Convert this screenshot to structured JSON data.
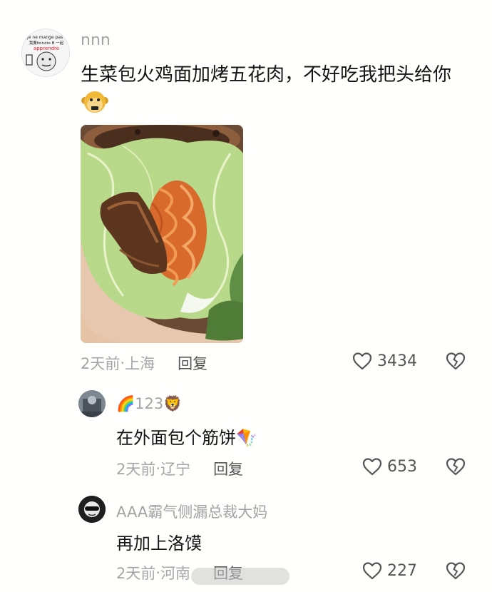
{
  "comments": [
    {
      "username": "nnn",
      "text": "生菜包火鸡面加烤五花肉，不好吃我把头给你",
      "emoji": "monkey-emoji",
      "avatar_text": {
        "line1": "Je ne mange pas ,",
        "line2": "我要feindre B 一起",
        "line3": "apprendre"
      },
      "time": "2天前",
      "location": "上海",
      "reply_label": "回复",
      "likes": "3434"
    },
    {
      "username": "🌈123🦁",
      "text": "在外面包个筋饼🪁",
      "time": "2天前",
      "location": "辽宁",
      "reply_label": "回复",
      "likes": "653"
    },
    {
      "username": "AAA霸气侧漏总裁大妈",
      "text": "再加上洛馍",
      "time": "2天前",
      "location": "河南",
      "reply_label": "回复",
      "likes": "227"
    }
  ],
  "separator": " · ",
  "icons": {
    "like": "heart-icon",
    "dislike": "broken-heart-icon"
  },
  "colors": {
    "meta": "#a6a6a6",
    "text": "#141414",
    "icon": "#555555"
  }
}
